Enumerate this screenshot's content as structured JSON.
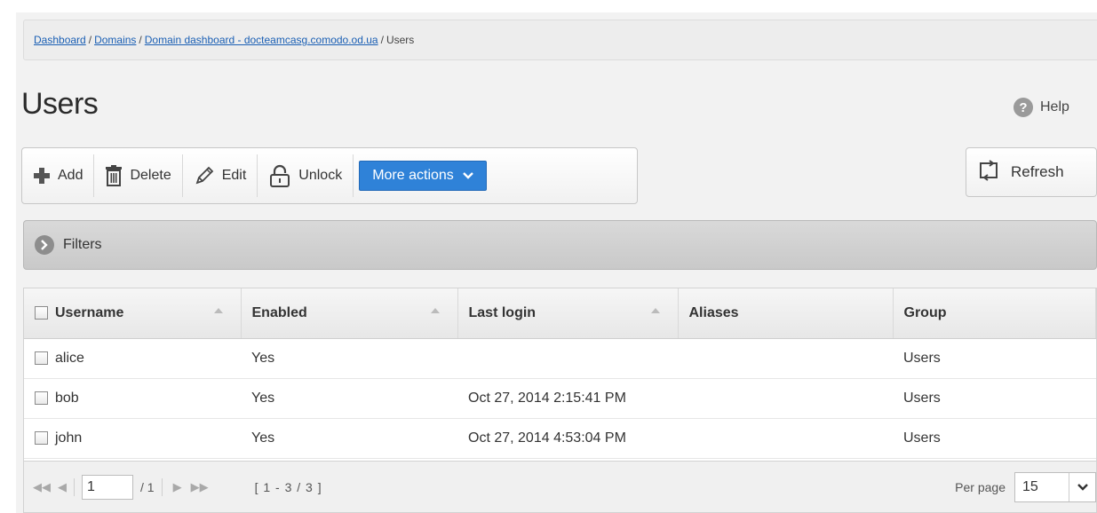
{
  "breadcrumb": {
    "items": [
      "Dashboard",
      "Domains",
      "Domain dashboard - docteamcasg.comodo.od.ua"
    ],
    "current": "Users",
    "separator": "/"
  },
  "page": {
    "title": "Users"
  },
  "help": {
    "icon": "question-icon",
    "label": "Help"
  },
  "toolbar": {
    "add": "Add",
    "delete": "Delete",
    "edit": "Edit",
    "unlock": "Unlock",
    "more_actions": "More actions",
    "refresh": "Refresh"
  },
  "filters": {
    "label": "Filters"
  },
  "table": {
    "columns": [
      "Username",
      "Enabled",
      "Last login",
      "Aliases",
      "Group"
    ],
    "rows": [
      {
        "username": "alice",
        "enabled": "Yes",
        "last_login": "",
        "aliases": "",
        "group": "Users"
      },
      {
        "username": "bob",
        "enabled": "Yes",
        "last_login": "Oct 27, 2014 2:15:41 PM",
        "aliases": "",
        "group": "Users"
      },
      {
        "username": "john",
        "enabled": "Yes",
        "last_login": "Oct 27, 2014 4:53:04 PM",
        "aliases": "",
        "group": "Users"
      }
    ]
  },
  "pager": {
    "page": "1",
    "of": "/ 1",
    "range": "[ 1 - 3 / 3 ]",
    "per_page_label": "Per page",
    "per_page_value": "15"
  },
  "colors": {
    "accent": "#2f82d8",
    "link": "#1a5fb4"
  }
}
